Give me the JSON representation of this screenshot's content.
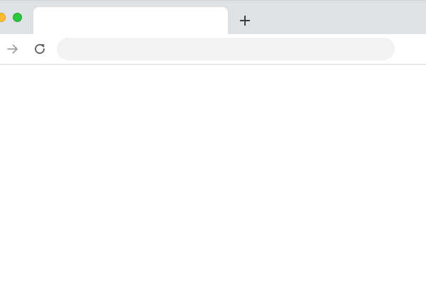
{
  "window": {
    "controls": [
      "minimize",
      "zoom"
    ]
  },
  "tabs": [
    {
      "title": "",
      "active": true
    }
  ],
  "toolbar": {
    "forward_icon": "arrow-right-icon",
    "reload_icon": "reload-icon",
    "new_tab_icon": "plus-icon"
  },
  "omnibox": {
    "value": "",
    "placeholder": ""
  },
  "page": {
    "content": ""
  },
  "colors": {
    "tabstrip": "#dee1e6",
    "active_tab": "#ffffff",
    "omnibox": "#f1f3f4",
    "minimize": "#febc2e",
    "zoom": "#28c840",
    "icon_disabled": "#9aa0a6",
    "icon_enabled": "#5f6368"
  }
}
